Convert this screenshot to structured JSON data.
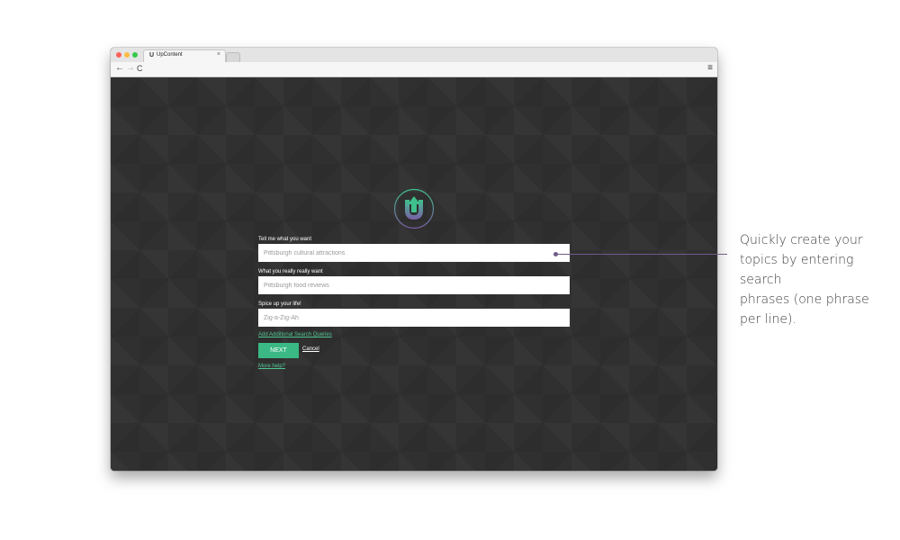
{
  "browser": {
    "tab_favicon": "U",
    "tab_title": "UpContent",
    "tab_close": "×",
    "back_icon": "←",
    "forward_icon": "→",
    "reload_icon": "C",
    "menu_icon": "≡"
  },
  "page": {
    "logo_letter": "U",
    "fields": [
      {
        "label": "Tell me what you want",
        "placeholder": "Pittsburgh cultural attractions"
      },
      {
        "label": "What you really really want",
        "placeholder": "Pittsburgh food reviews"
      },
      {
        "label": "Spice up your life!",
        "placeholder": "Zig-a-Zig-Ah"
      }
    ],
    "add_queries_link": "Add Additional Search Queries",
    "next_button": "NEXT",
    "cancel_link": "Cancel",
    "help_link": "More help?"
  },
  "callout": {
    "lines": [
      "Quickly create your",
      "topics by entering search",
      "phrases (one phrase",
      "per line)."
    ]
  },
  "colors": {
    "accent_green": "#3ab984",
    "link_green": "#4fc694",
    "callout_line": "#6e5c8a",
    "background": "#303030"
  }
}
